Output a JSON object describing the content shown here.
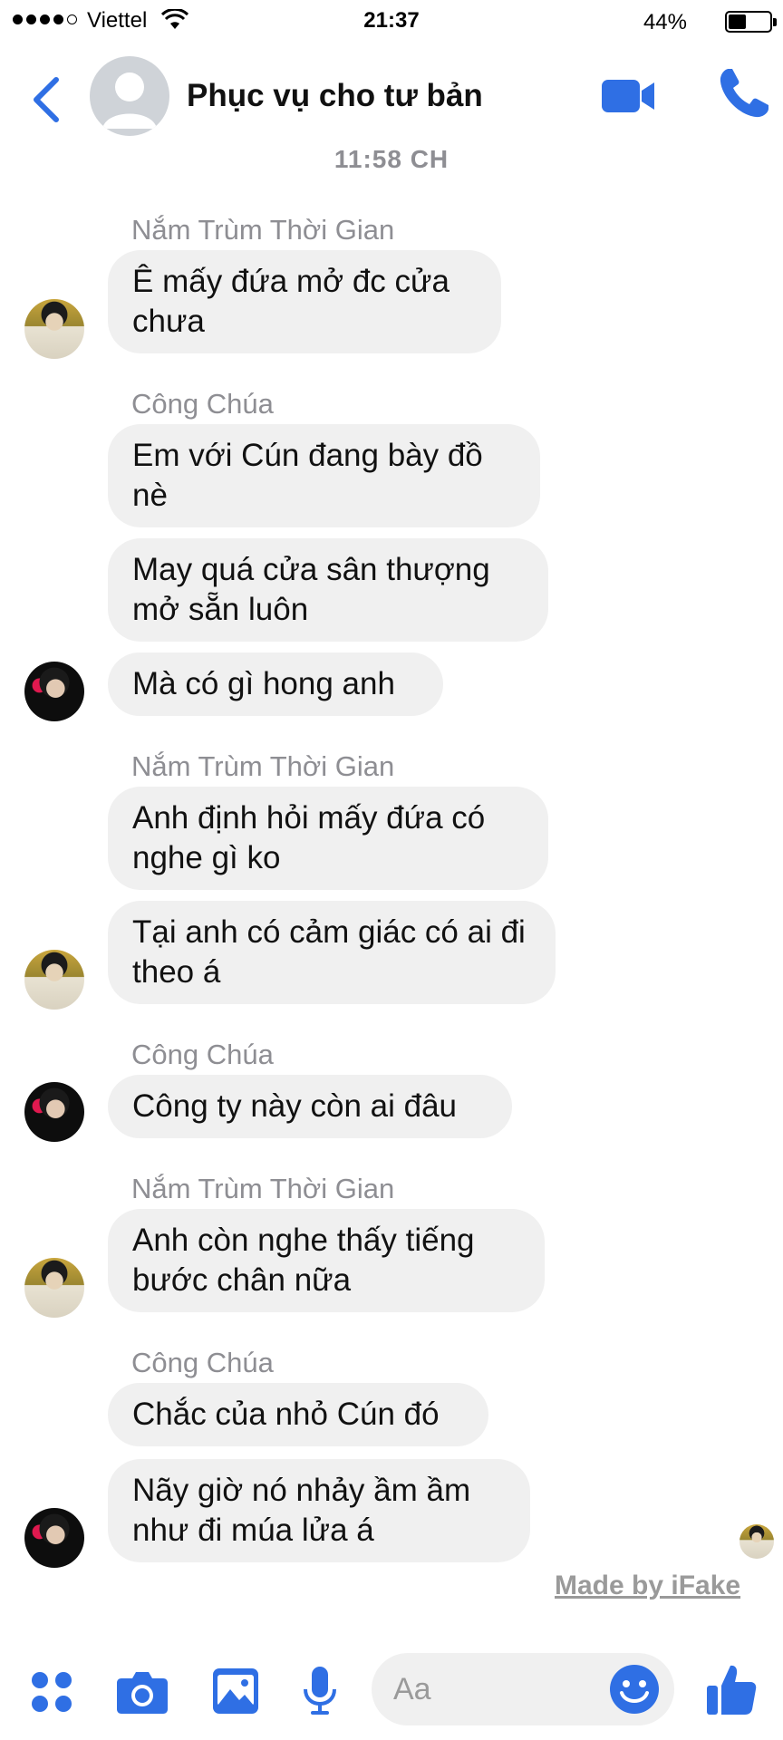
{
  "status_bar": {
    "carrier": "Viettel",
    "time": "21:37",
    "battery_percent": "44%",
    "battery_level": 0.44
  },
  "header": {
    "title": "Phục vụ cho tư bản",
    "icons": [
      "back-chevron-icon",
      "video-call-icon",
      "phone-icon"
    ]
  },
  "thread": {
    "timestamp": "11:58 CH",
    "groups": [
      {
        "sender": "Nắm Trùm Thời Gian",
        "messages": [
          "Ê mấy đứa mở đc cửa chưa"
        ]
      },
      {
        "sender": "Công Chúa",
        "messages": [
          "Em với Cún đang bày đồ nè",
          "May quá cửa sân thượng mở sẵn luôn",
          "Mà có gì hong anh"
        ]
      },
      {
        "sender": "Nắm Trùm Thời Gian",
        "messages": [
          "Anh định hỏi mấy đứa có nghe gì ko",
          "Tại anh có cảm giác có ai đi theo á"
        ]
      },
      {
        "sender": "Công Chúa",
        "messages": [
          "Công ty này còn ai đâu"
        ]
      },
      {
        "sender": "Nắm Trùm Thời Gian",
        "messages": [
          "Anh còn nghe thấy tiếng bước chân nữa"
        ]
      },
      {
        "sender": "Công Chúa",
        "messages": [
          "Chắc của nhỏ Cún đó",
          "Nãy giờ nó nhảy ầm ầm như đi múa lửa á"
        ]
      }
    ]
  },
  "watermark": "Made by iFake",
  "composer": {
    "placeholder": "Aa",
    "icons": [
      "apps-icon",
      "camera-icon",
      "image-icon",
      "microphone-icon",
      "emoji-icon",
      "like-thumb-icon"
    ]
  },
  "colors": {
    "accent": "#2f6fe4",
    "bubble": "#f0f0f0",
    "meta_text": "#8e8e93"
  }
}
